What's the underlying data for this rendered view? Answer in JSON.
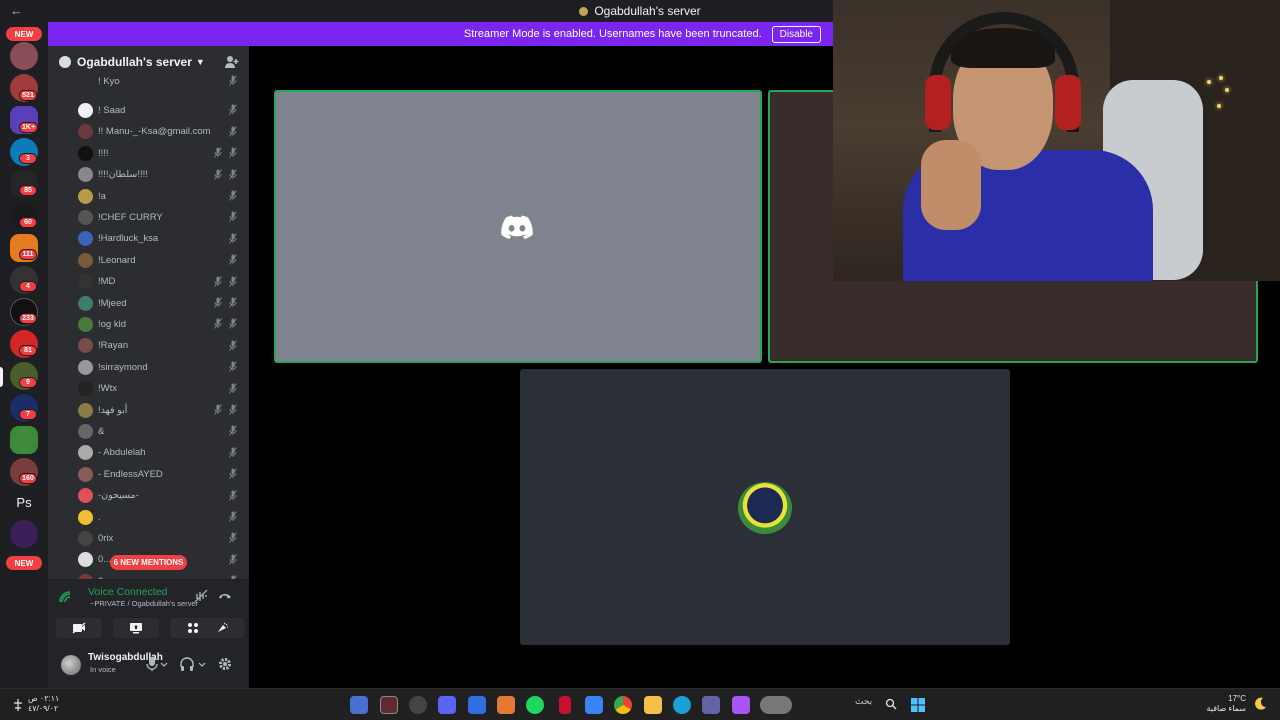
{
  "titlebar": {
    "title": "Ogabdullah's server"
  },
  "banner": {
    "text": "Streamer Mode is enabled. Usernames have been truncated.",
    "button": "Disable"
  },
  "rail": {
    "badges": [
      "521",
      "1K+",
      "3",
      "85",
      "60",
      "111",
      "4",
      "233",
      "81",
      "9",
      "7",
      "160"
    ],
    "new_top": "NEW",
    "new_bottom": "NEW",
    "ps": "Ps"
  },
  "server": {
    "name": "Ogabdullah's server"
  },
  "members": [
    {
      "name": "! Kyo"
    },
    {
      "name": "! Saad"
    },
    {
      "name": "!! Manu-_-Ksa@gmail.com"
    },
    {
      "name": "!!!!"
    },
    {
      "name": "!!!!سلطان!!!!"
    },
    {
      "name": "!a"
    },
    {
      "name": "!CHEF CURRY"
    },
    {
      "name": "!Hardluck_ksa"
    },
    {
      "name": "!Leonard"
    },
    {
      "name": "!MD"
    },
    {
      "name": "!Mjeed"
    },
    {
      "name": "!og kld"
    },
    {
      "name": "!Rayan"
    },
    {
      "name": "!sirraymond"
    },
    {
      "name": "!Wtx"
    },
    {
      "name": "!أبو فهد"
    },
    {
      "name": "&"
    },
    {
      "name": "- Abdulelah"
    },
    {
      "name": "- EndlessAYED"
    },
    {
      "name": "-مسيحون-"
    },
    {
      "name": "."
    },
    {
      "name": "0rix"
    },
    {
      "name": "0..."
    },
    {
      "name": "2..."
    }
  ],
  "mentions": "6 NEW MENTIONS",
  "voice": {
    "title": "Voice Connected",
    "channel": "~PRIVATE / Ogabdullah's server"
  },
  "user": {
    "name": "Twisogabdullah",
    "status": "In voice"
  },
  "taskbar": {
    "time": "٠٢:١١ ص",
    "date": "٤٧/٠٩/٠٢",
    "search": "بحث",
    "temp": "17°C",
    "weather": "سماء صافية"
  },
  "colors": {
    "accent": "#7a25f1",
    "green": "#23a55a",
    "red": "#f23f43"
  }
}
